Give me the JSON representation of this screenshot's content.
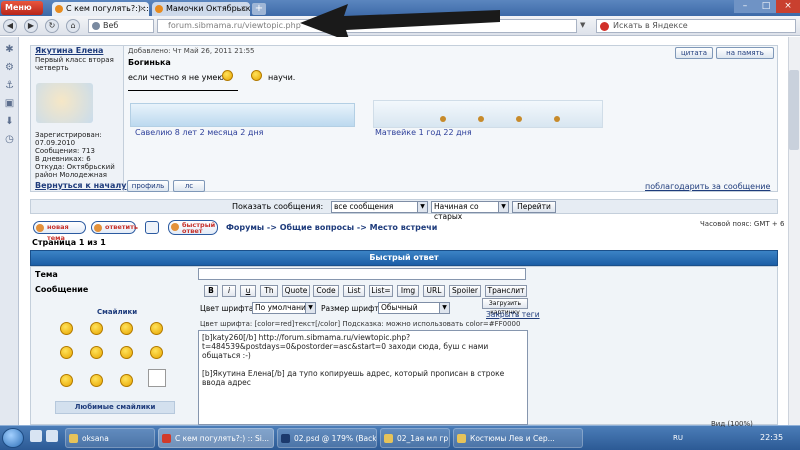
{
  "browser": {
    "menu_label": "Меню",
    "tabs": [
      {
        "title": "С кем погулять?:) :: Si..."
      },
      {
        "title": "Мамочки Октябрьско..."
      }
    ],
    "web_label": "Веб",
    "url": "forum.sibmama.ru/viewtopic.php",
    "search_placeholder": "Искать в Яндексе",
    "zoom": "Вид (100%)"
  },
  "post": {
    "author": "Якутина Елена",
    "rank": "Первый класс вторая четверть",
    "registered": "Зарегистрирован: 07.09.2010",
    "messages": "Сообщения: 713",
    "diaries": "В дневниках: 6",
    "from": "Откуда: Октябрьский район Молодежная",
    "date": "Добавлено: Чт Май 26, 2011 21:55",
    "subject": "Богинька",
    "text_before": "если честно я не умею.",
    "text_after": "научи.",
    "signature_1": "Савелию 8 лет 2 месяца 2 дня",
    "signature_2": "Матвейке  1 год 22 дня",
    "quote_btn": "цитата",
    "remind_btn": "на память",
    "profile_btn": "профиль",
    "pm_btn": "лс",
    "to_top": "Вернуться к началу",
    "thanks": "поблагодарить за сообщение"
  },
  "display_bar": {
    "label": "Показать сообщения:",
    "filter": "все сообщения",
    "order": "Начиная со старых",
    "go": "Перейти"
  },
  "topic_nav": {
    "new_topic": "новая тема",
    "reply": "ответить",
    "fast_reply": "быстрый ответ",
    "breadcrumb": "Форумы -> Общие вопросы -> Место встречи",
    "timezone": "Часовой пояс: GMT + 6",
    "pages": "Страница 1 из 1"
  },
  "quick_reply": {
    "header": "Быстрый ответ",
    "topic_label": "Тема",
    "message_label": "Сообщение",
    "format_buttons": [
      "B",
      "i",
      "u",
      "Th",
      "Quote",
      "Code",
      "List",
      "List=",
      "Img",
      "URL",
      "Spoiler",
      "Транслит"
    ],
    "font_label": "Цвет шрифта:",
    "font_value": "По умолчанию",
    "size_label": "Размер шрифта:",
    "size_value": "Обычный",
    "upload": "Загрузить картинку",
    "close_tabs": "Закрыть теги",
    "color_hint": "Цвет шрифта: [color=red]текст[/color]  Подсказка: можно использовать color=#FF0000",
    "smileys_title": "Смайлики",
    "fav_smileys": "Любимые смайлики",
    "message_line1": "[b]katy260[/b] http://forum.sibmama.ru/viewtopic.php?",
    "message_line2": "t=484539&postdays=0&postorder=asc&start=0 заходи сюда, буш с нами общаться  :-)",
    "message_line3": "[b]Якутина Елена[/b] да тупо копируешь адрес, который прописан в строке ввода адрес"
  },
  "taskbar": {
    "tasks": [
      "oksana",
      "С кем погулять?:) :: Si...",
      "02.psd @ 179% (Back...",
      "02_1ая мл гр",
      "Костюмы Лев и Сер..."
    ],
    "lang": "RU",
    "clock": "22:35"
  }
}
